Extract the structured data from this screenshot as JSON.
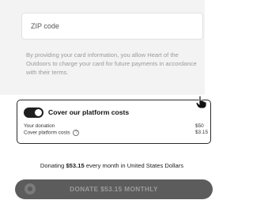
{
  "billing": {
    "zip_placeholder": "ZIP code",
    "consent_text": "By providing your card information, you allow Heart of the Outdoors to charge your card for future payments in accordance with their terms."
  },
  "cover_costs": {
    "title": "Cover our platform costs",
    "enabled": true,
    "donation_label": "Your donation",
    "donation_value": "$50",
    "fee_label": "Cover platform costs",
    "fee_value": "$3.15",
    "help_icon": "question-circle-icon"
  },
  "summary": {
    "prefix": "Donating",
    "amount": "$53.15",
    "suffix": "every month in United States Dollars"
  },
  "donate_button": {
    "label": "DONATE $53.15 MONTHLY",
    "icon": "lock-icon"
  },
  "colors": {
    "panel_bg": "#f3f3f3",
    "button_bg": "#5c5c5c",
    "toggle_on": "#1f1f1f"
  }
}
